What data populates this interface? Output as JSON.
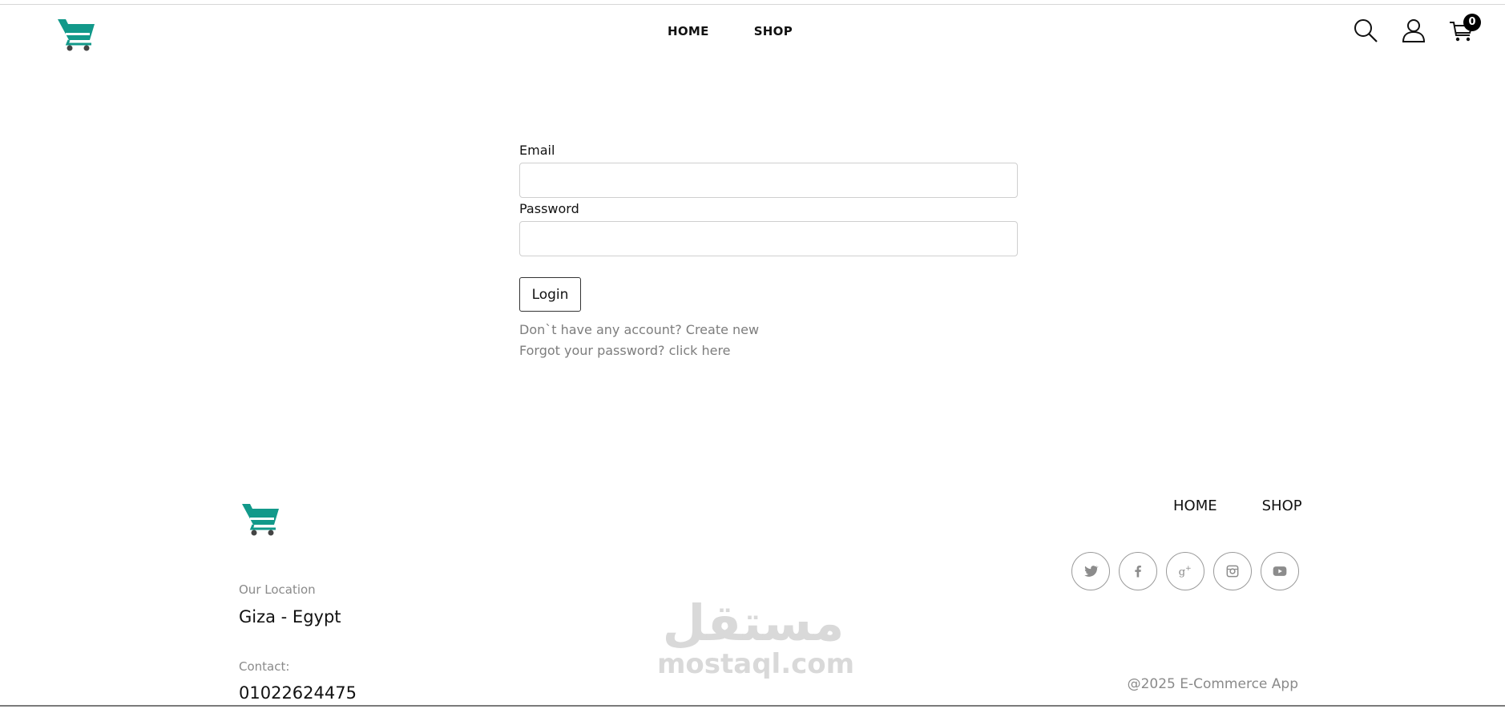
{
  "header": {
    "logo_icon": "cart-logo",
    "nav": [
      {
        "label": "HOME"
      },
      {
        "label": "SHOP"
      }
    ],
    "icons": [
      "search-icon",
      "user-icon",
      "cart-icon"
    ],
    "cart_count": "0"
  },
  "login_form": {
    "email_label": "Email",
    "email_value": "",
    "password_label": "Password",
    "password_value": "",
    "login_button": "Login",
    "signup_prompt": "Don`t have any account? Create new",
    "forgot_prompt": "Forgot your password? click here"
  },
  "footer": {
    "logo_icon": "cart-logo",
    "nav": [
      {
        "label": "HOME"
      },
      {
        "label": "SHOP"
      }
    ],
    "social": [
      "twitter-icon",
      "facebook-icon",
      "google-plus-icon",
      "instagram-icon",
      "youtube-icon"
    ],
    "location_label": "Our Location",
    "location_value": "Giza - Egypt",
    "contact_label": "Contact:",
    "contact_value": "01022624475",
    "copyright": "@2025 E-Commerce App"
  },
  "watermark": {
    "arabic": "مستقل",
    "latin": "mostaql.com"
  },
  "colors": {
    "brand_teal": "#12998a",
    "text": "#111111",
    "muted": "#7d7d7d",
    "watermark": "#d9d9d9"
  }
}
